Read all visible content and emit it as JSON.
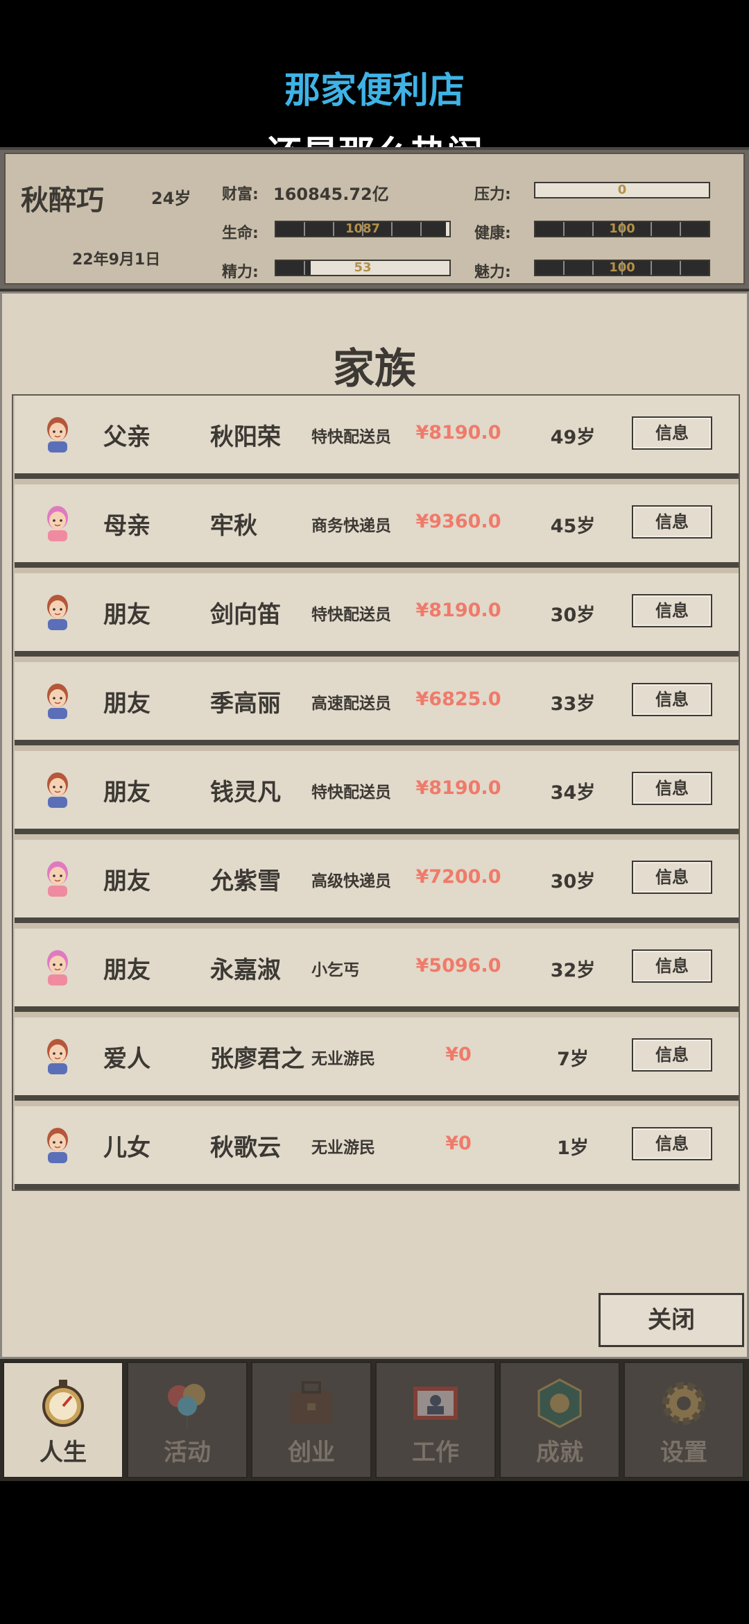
{
  "caption": {
    "line1": "那家便利店",
    "line2": "还是那么热闹"
  },
  "player": {
    "name": "秋醉巧",
    "age": "24岁",
    "date": "22年9月1日",
    "wealth_label": "财富:",
    "wealth_value": "160845.72亿",
    "life_label": "生命:",
    "life_value": "1087",
    "life_level": 0.98,
    "energy_label": "精力:",
    "energy_value": "53",
    "energy_level": 0.2,
    "pressure_label": "压力:",
    "pressure_value": "0",
    "pressure_level": 0,
    "health_label": "健康:",
    "health_value": "100",
    "health_level": 1.0,
    "charm_label": "魅力:",
    "charm_value": "100",
    "charm_level": 1.0
  },
  "panel": {
    "title": "家族",
    "close_label": "关闭",
    "info_label": "信息",
    "members": [
      {
        "relation": "父亲",
        "name": "秋阳荣",
        "job": "特快配送员",
        "salary": "¥8190.0",
        "age": "49岁",
        "avatar": "male-avatar-icon"
      },
      {
        "relation": "母亲",
        "name": "牢秋",
        "job": "商务快递员",
        "salary": "¥9360.0",
        "age": "45岁",
        "avatar": "female-avatar-icon"
      },
      {
        "relation": "朋友",
        "name": "剑向笛",
        "job": "特快配送员",
        "salary": "¥8190.0",
        "age": "30岁",
        "avatar": "male-avatar-icon"
      },
      {
        "relation": "朋友",
        "name": "季高丽",
        "job": "高速配送员",
        "salary": "¥6825.0",
        "age": "33岁",
        "avatar": "male-avatar-icon"
      },
      {
        "relation": "朋友",
        "name": "钱灵凡",
        "job": "特快配送员",
        "salary": "¥8190.0",
        "age": "34岁",
        "avatar": "male-avatar-icon"
      },
      {
        "relation": "朋友",
        "name": "允紫雪",
        "job": "高级快递员",
        "salary": "¥7200.0",
        "age": "30岁",
        "avatar": "female-avatar-icon"
      },
      {
        "relation": "朋友",
        "name": "永嘉淑",
        "job": "小乞丐",
        "salary": "¥5096.0",
        "age": "32岁",
        "avatar": "female-avatar-icon"
      },
      {
        "relation": "爱人",
        "name": "张廖君之",
        "job": "无业游民",
        "salary": "¥0",
        "age": "7岁",
        "avatar": "male-avatar-icon"
      },
      {
        "relation": "儿女",
        "name": "秋歌云",
        "job": "无业游民",
        "salary": "¥0",
        "age": "1岁",
        "avatar": "male-avatar-icon"
      }
    ]
  },
  "nav": {
    "tabs": [
      {
        "label": "人生",
        "icon": "stopwatch-icon",
        "active": true
      },
      {
        "label": "活动",
        "icon": "balloons-icon",
        "active": false
      },
      {
        "label": "创业",
        "icon": "briefcase-icon",
        "active": false
      },
      {
        "label": "工作",
        "icon": "id-card-icon",
        "active": false
      },
      {
        "label": "成就",
        "icon": "badge-icon",
        "active": false
      },
      {
        "label": "设置",
        "icon": "gear-icon",
        "active": false
      }
    ]
  },
  "colors": {
    "accent": "#3fb3e6",
    "salary": "#f07a6a",
    "panel": "#dcd3c3"
  }
}
